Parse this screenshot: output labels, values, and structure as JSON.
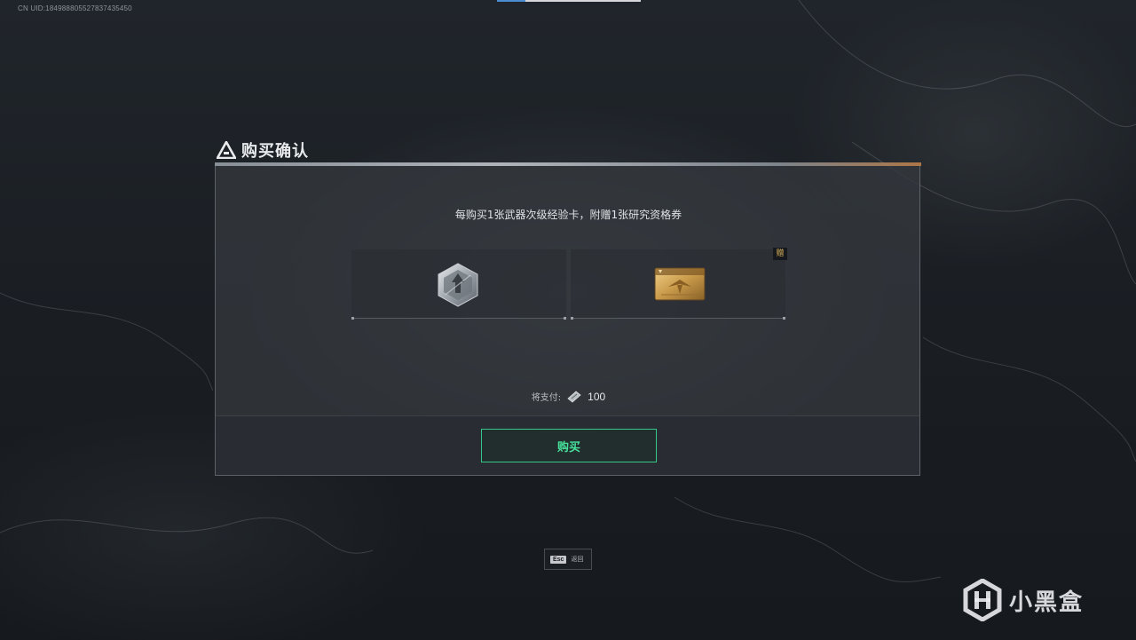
{
  "header": {
    "uid_text": "CN UID:184988805527837435450"
  },
  "dialog": {
    "title": "购买确认",
    "message": "每购买1张武器次级经验卡，附赠1张研究资格券",
    "items": [
      {
        "icon": "weapon-exp-card-hex-icon"
      },
      {
        "icon": "research-ticket-card-icon",
        "badge": "赠"
      }
    ],
    "pay_label": "将支付:",
    "pay_currency_icon": "ticket-currency-icon",
    "pay_amount": "100",
    "buy_button": "购买"
  },
  "footer": {
    "esc_key": "Esc",
    "esc_label": "返回"
  },
  "watermark": {
    "text": "小黑盒"
  },
  "colors": {
    "accent_green": "#46e29c",
    "gift_gold": "#d9b15c",
    "uid_blue_segment": "#4a8cd0"
  }
}
